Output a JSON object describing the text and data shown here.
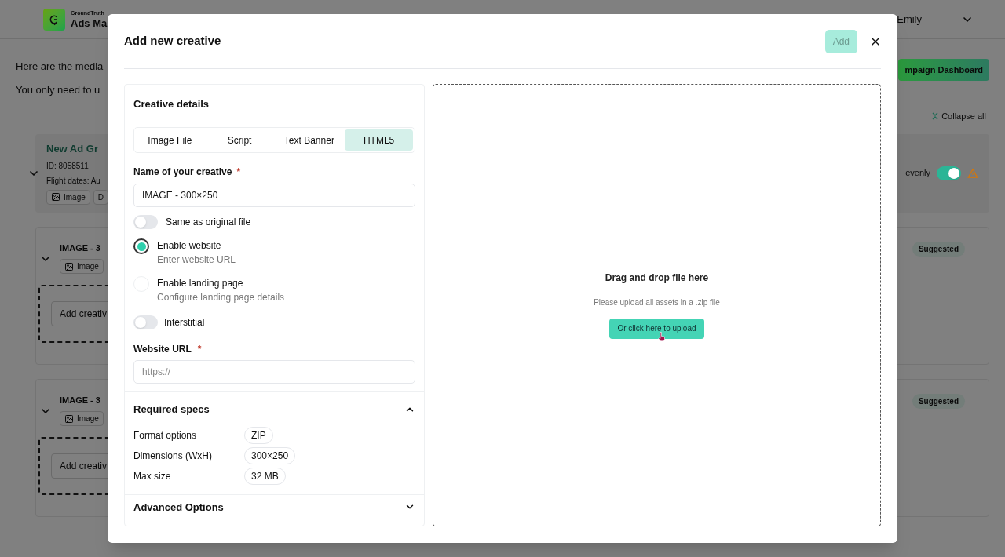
{
  "background": {
    "brand_small": "GroundTruth",
    "brand_name": "Ads Ma",
    "user": "Emily",
    "intro_lines": [
      "Here are the media",
      "You only need to u"
    ],
    "dashboard_button": "mpaign Dashboard",
    "collapse_all": "Collapse all",
    "ad_group": {
      "title": "New Ad Gr",
      "id": "ID: 8058511",
      "flight": "Flight dates: Au",
      "chips": [
        "Image",
        "D"
      ],
      "toggle_label": "evenly",
      "toggle_on": true
    },
    "creatives": [
      {
        "title": "IMAGE - 3",
        "chip": "Image",
        "badge": "Suggested",
        "add_button": "Add creativ"
      },
      {
        "title": "IMAGE - 3",
        "chip": "Image",
        "badge": "Suggested",
        "add_button": "Add creativ"
      }
    ]
  },
  "dialog": {
    "title": "Add new creative",
    "add_button": {
      "label": "Add",
      "disabled": true
    },
    "details": {
      "title": "Creative details",
      "tabs": [
        {
          "label": "Image File",
          "selected": false
        },
        {
          "label": "Script",
          "selected": false
        },
        {
          "label": "Text Banner",
          "selected": false
        },
        {
          "label": "HTML5",
          "selected": true
        }
      ],
      "name_label": "Name of your creative",
      "name_required": "*",
      "name_value": "IMAGE - 300×250",
      "same_toggle": {
        "label": "Same as original file",
        "on": false
      },
      "radios": [
        {
          "label": "Enable website",
          "hint": "Enter website URL",
          "selected": true
        },
        {
          "label": "Enable landing page",
          "hint": "Configure landing page details",
          "selected": false
        }
      ],
      "interstitial": {
        "label": "Interstitial",
        "on": false
      },
      "url_label": "Website URL",
      "url_required": "*",
      "url_placeholder": "https://"
    },
    "specs": {
      "title": "Required specs",
      "expanded": true,
      "rows": [
        {
          "label": "Format options",
          "value": "ZIP"
        },
        {
          "label": "Dimensions (WxH)",
          "value": "300×250"
        },
        {
          "label": "Max size",
          "value": "32 MB"
        }
      ]
    },
    "advanced": {
      "title": "Advanced Options",
      "expanded": false
    },
    "dropzone": {
      "title": "Drag and drop file here",
      "hint": "Please upload all assets in a .zip file",
      "button": "Or click here to upload"
    }
  }
}
